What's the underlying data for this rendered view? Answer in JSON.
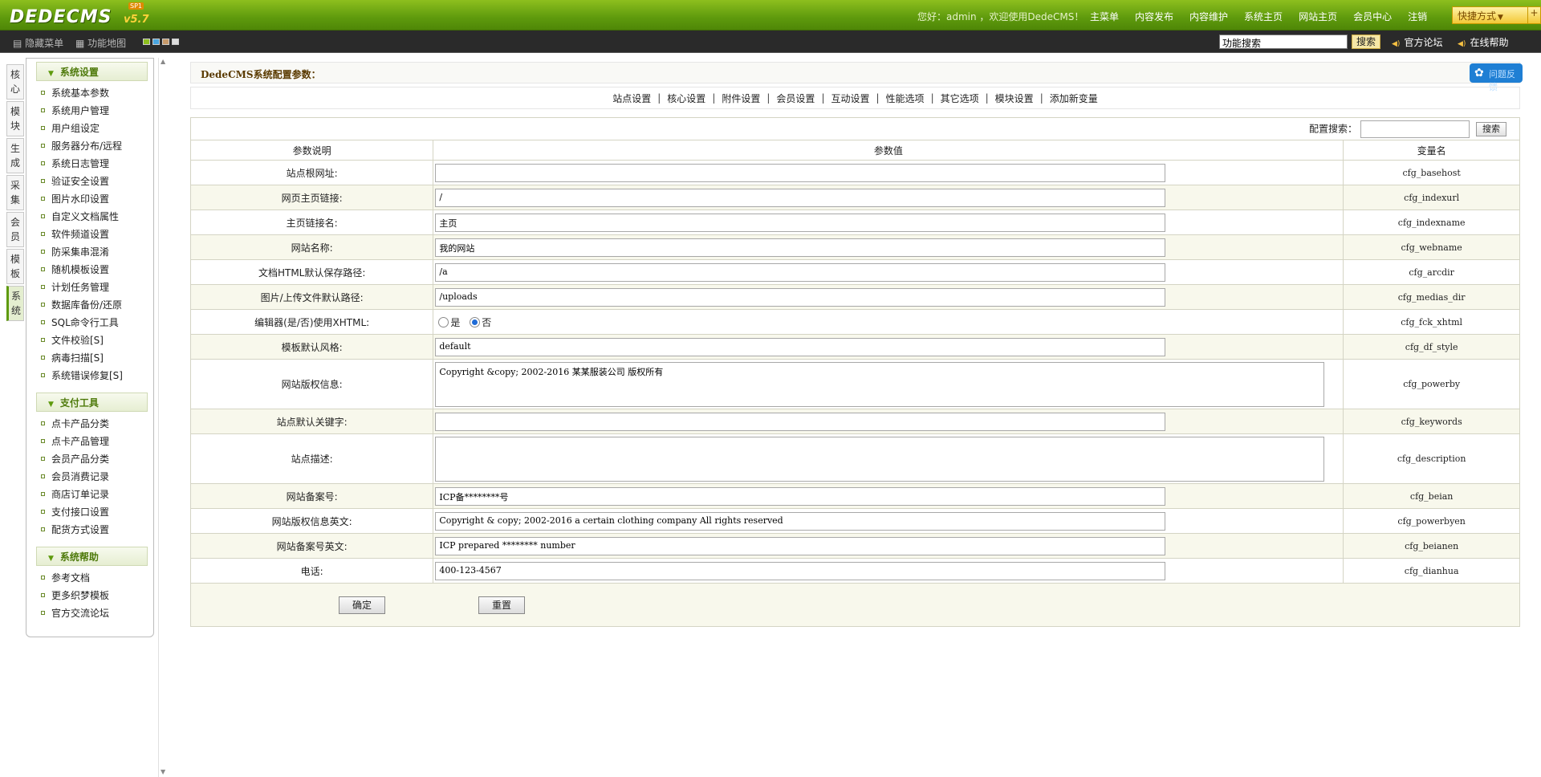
{
  "header": {
    "logo": "DEDECMS",
    "version": "v5.7",
    "badge": "SP1",
    "welcome": "您好：admin ，欢迎使用DedeCMS！",
    "nav": [
      "主菜单",
      "内容发布",
      "内容维护",
      "系统主页",
      "网站主页",
      "会员中心",
      "注销"
    ],
    "quick": "快捷方式"
  },
  "subbar": {
    "hide_menu": "隐藏菜单",
    "func_map": "功能地图",
    "search_value": "功能搜索",
    "search_btn": "搜索",
    "forum": "官方论坛",
    "help": "在线帮助"
  },
  "vtabs": [
    "核心",
    "模块",
    "生成",
    "采集",
    "会员",
    "模板",
    "系统"
  ],
  "menu": [
    {
      "title": "系统设置",
      "items": [
        "系统基本参数",
        "系统用户管理",
        "用户组设定",
        "服务器分布/远程",
        "系统日志管理",
        "验证安全设置",
        "图片水印设置",
        "自定义文档属性",
        "软件频道设置",
        "防采集串混淆",
        "随机模板设置",
        "计划任务管理",
        "数据库备份/还原",
        "SQL命令行工具",
        "文件校验[S]",
        "病毒扫描[S]",
        "系统错误修复[S]"
      ]
    },
    {
      "title": "支付工具",
      "items": [
        "点卡产品分类",
        "点卡产品管理",
        "会员产品分类",
        "会员消费记录",
        "商店订单记录",
        "支付接口设置",
        "配货方式设置"
      ]
    },
    {
      "title": "系统帮助",
      "items": [
        "参考文档",
        "更多织梦模板",
        "官方交流论坛"
      ]
    }
  ],
  "main": {
    "title": "DedeCMS系统配置参数：",
    "feedback": "问题反馈",
    "tabs": [
      "站点设置",
      "核心设置",
      "附件设置",
      "会员设置",
      "互动设置",
      "性能选项",
      "其它选项",
      "模块设置",
      "添加新变量"
    ],
    "search_label": "配置搜索：",
    "search_btn": "搜索",
    "headers": [
      "参数说明",
      "参数值",
      "变量名"
    ],
    "rows": [
      {
        "label": "站点根网址:",
        "value": "",
        "var": "cfg_basehost"
      },
      {
        "label": "网页主页链接:",
        "value": "/",
        "var": "cfg_indexurl"
      },
      {
        "label": "主页链接名:",
        "value": "主页",
        "var": "cfg_indexname"
      },
      {
        "label": "网站名称:",
        "value": "我的网站",
        "var": "cfg_webname"
      },
      {
        "label": "文档HTML默认保存路径:",
        "value": "/a",
        "var": "cfg_arcdir"
      },
      {
        "label": "图片/上传文件默认路径:",
        "value": "/uploads",
        "var": "cfg_medias_dir"
      },
      {
        "label": "编辑器(是/否)使用XHTML:",
        "radio_yes": "是",
        "radio_no": "否",
        "var": "cfg_fck_xhtml"
      },
      {
        "label": "模板默认风格:",
        "value": "default",
        "var": "cfg_df_style"
      },
      {
        "label": "网站版权信息:",
        "value": "Copyright &copy; 2002-2016  某某服装公司 版权所有",
        "var": "cfg_powerby"
      },
      {
        "label": "站点默认关键字:",
        "value": "",
        "var": "cfg_keywords"
      },
      {
        "label": "站点描述:",
        "value": "",
        "var": "cfg_description"
      },
      {
        "label": "网站备案号:",
        "value": "ICP备********号",
        "var": "cfg_beian"
      },
      {
        "label": "网站版权信息英文:",
        "value": "Copyright & copy; 2002-2016 a certain clothing company All rights reserved",
        "var": "cfg_powerbyen"
      },
      {
        "label": "网站备案号英文:",
        "value": "ICP prepared ******** number",
        "var": "cfg_beianen"
      },
      {
        "label": "电话:",
        "value": "400-123-4567",
        "var": "cfg_dianhua"
      }
    ],
    "submit": "确定",
    "reset": "重置"
  }
}
